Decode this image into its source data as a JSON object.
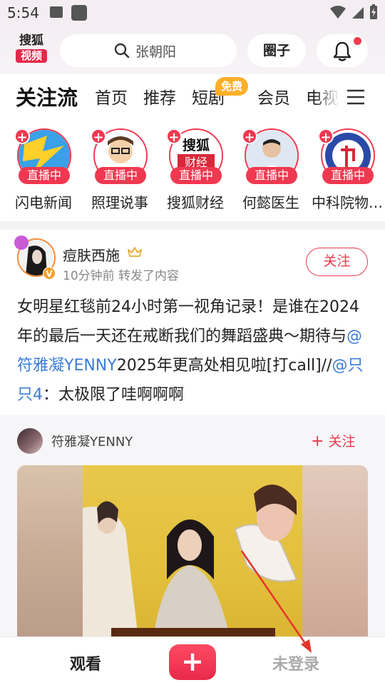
{
  "status_bar": {
    "time": "5:54"
  },
  "header": {
    "logo_top": "搜狐",
    "logo_bottom": "视频",
    "search_placeholder": "张朝阳",
    "circle_label": "圈子"
  },
  "tabs": {
    "items": [
      "关注流",
      "首页",
      "推荐",
      "短剧",
      "会员",
      "电视"
    ],
    "badge": "免费",
    "active": "关注流"
  },
  "live_row": {
    "badge": "直播中",
    "items": [
      {
        "name": "闪电新闻",
        "icon": "lightning-logo"
      },
      {
        "name": "照理说事",
        "icon": "cartoon-avatar"
      },
      {
        "name": "搜狐财经",
        "icon": "sohu-finance-logo",
        "logo_text": "搜狐",
        "logo_sub": "财经"
      },
      {
        "name": "何懿医生",
        "icon": "doctor-photo"
      },
      {
        "name": "中科院物…",
        "icon": "cas-logo"
      }
    ]
  },
  "post": {
    "author": "痘肤西施",
    "meta": "10分钟前 转发了内容",
    "follow_label": "关注",
    "text_parts": [
      "女明星红毯前24小时第一视角记录！是谁在2024年的最后一天还在戒断我们的舞蹈盛典～期待与",
      "@符雅凝YENNY",
      "2025年更高处相见啦[打call]//",
      "@只只4",
      "：太极限了哇啊啊啊"
    ]
  },
  "quoted": {
    "author": "符雅凝YENNY",
    "follow_label": "关注"
  },
  "bottom_nav": {
    "watch": "观看",
    "plus": "+",
    "login": "未登录"
  },
  "colors": {
    "accent": "#e83a4c",
    "mention": "#3b7dd8",
    "badge": "#ffb02a"
  }
}
